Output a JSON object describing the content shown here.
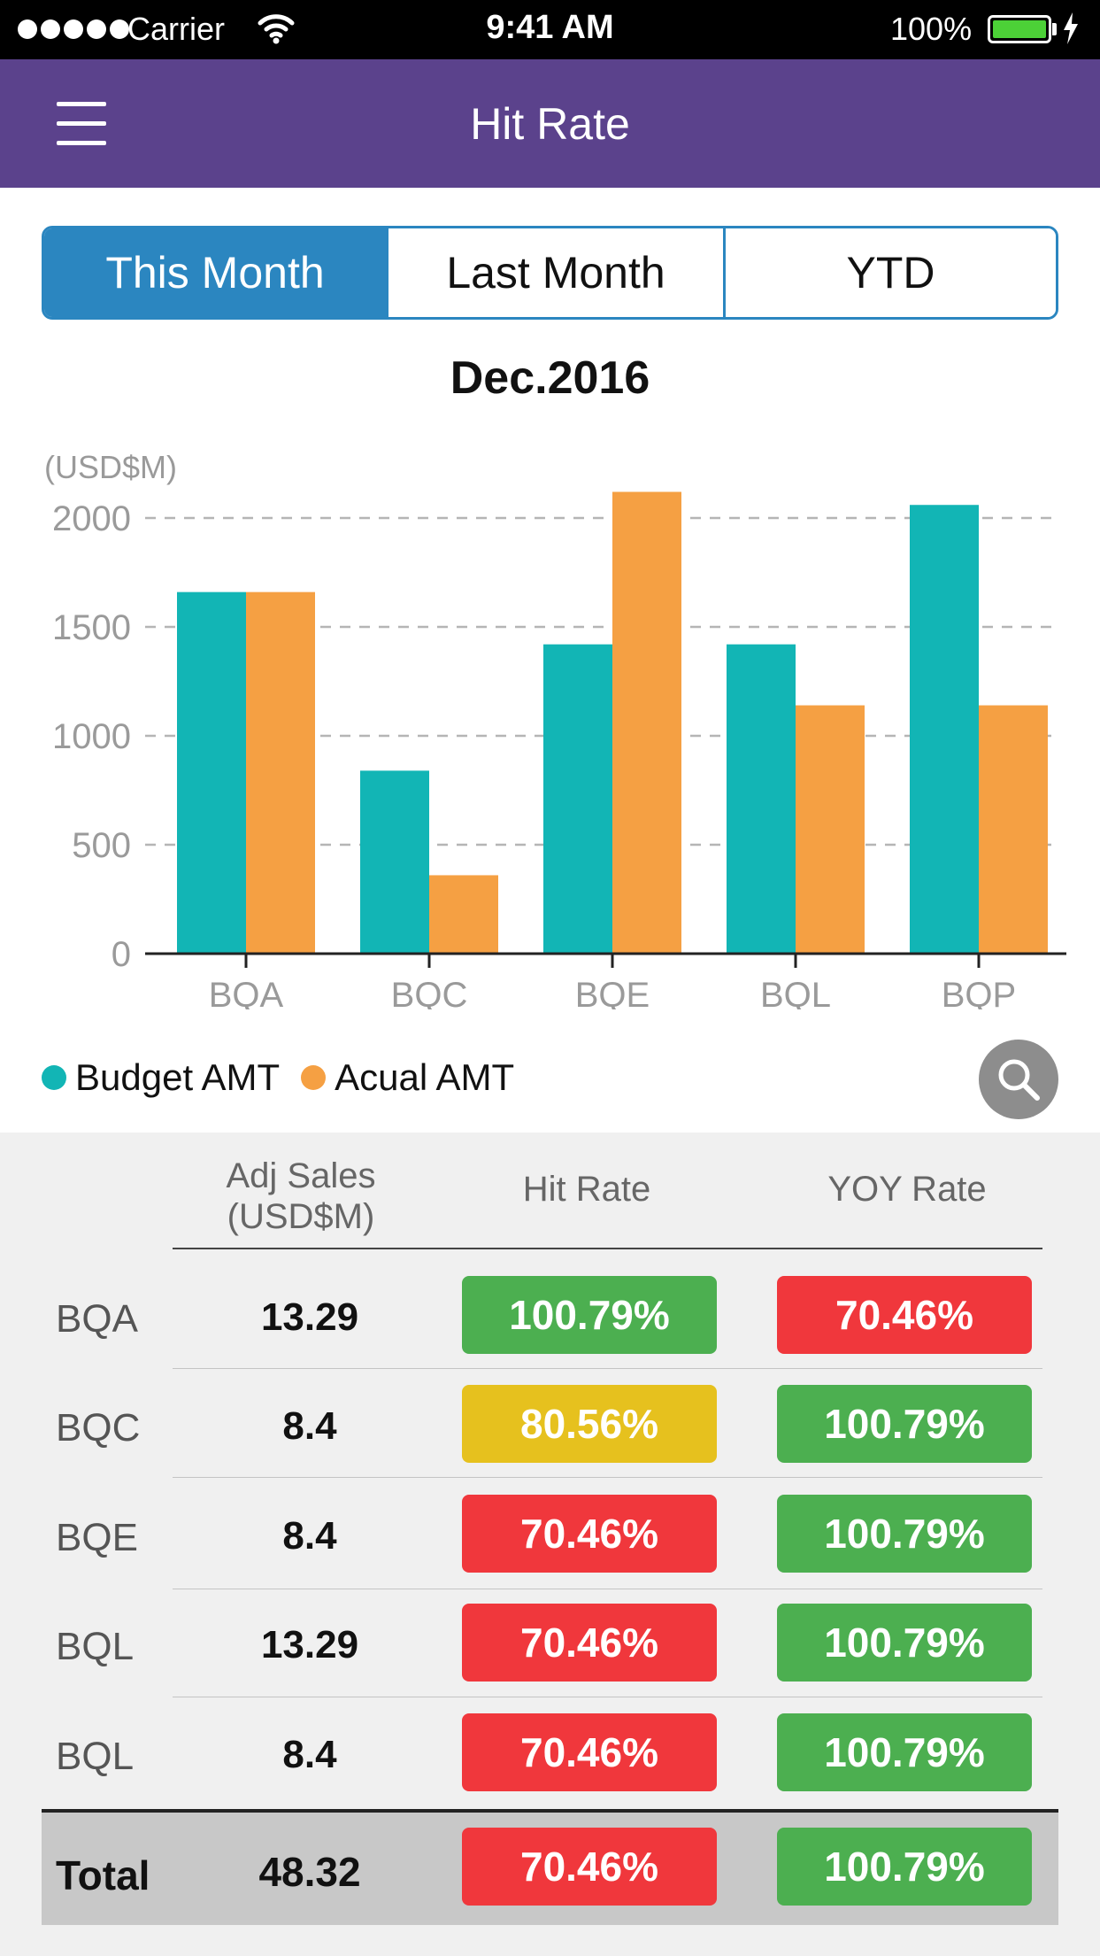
{
  "status_bar": {
    "carrier": "Carrier",
    "time": "9:41 AM",
    "battery": "100%"
  },
  "nav": {
    "title": "Hit Rate",
    "menu_icon": "hamburger-menu-icon"
  },
  "tabs": [
    {
      "label": "This Month",
      "active": true
    },
    {
      "label": "Last Month",
      "active": false
    },
    {
      "label": "YTD",
      "active": false
    }
  ],
  "period": "Dec.2016",
  "chart_data": {
    "type": "bar",
    "unit_label": "(USD$M)",
    "categories": [
      "BQA",
      "BQC",
      "BQE",
      "BQL",
      "BQP"
    ],
    "series": [
      {
        "name": "Budget AMT",
        "color": "#12b5b5",
        "values": [
          1660,
          840,
          1420,
          1420,
          2060
        ]
      },
      {
        "name": "Acual AMT",
        "color": "#f5a043",
        "values": [
          1660,
          360,
          2120,
          1140,
          1140
        ]
      }
    ],
    "yticks": [
      0,
      500,
      1000,
      1500,
      2000
    ],
    "ylim": [
      0,
      2200
    ],
    "grid": true,
    "legend": "bottom-left"
  },
  "search_icon": "search-icon",
  "table": {
    "headers": {
      "sales_line1": "Adj Sales",
      "sales_line2": "(USD$M)",
      "hit": "Hit Rate",
      "yoy": "YOY Rate"
    },
    "rows": [
      {
        "name": "BQA",
        "sales": "13.29",
        "hit": "100.79%",
        "hit_color": "#4caf50",
        "yoy": "70.46%",
        "yoy_color": "#f0373c"
      },
      {
        "name": "BQC",
        "sales": "8.4",
        "hit": "80.56%",
        "hit_color": "#e6c11e",
        "yoy": "100.79%",
        "yoy_color": "#4caf50"
      },
      {
        "name": "BQE",
        "sales": "8.4",
        "hit": "70.46%",
        "hit_color": "#f0373c",
        "yoy": "100.79%",
        "yoy_color": "#4caf50"
      },
      {
        "name": "BQL",
        "sales": "13.29",
        "hit": "70.46%",
        "hit_color": "#f0373c",
        "yoy": "100.79%",
        "yoy_color": "#4caf50"
      },
      {
        "name": "BQL",
        "sales": "8.4",
        "hit": "70.46%",
        "hit_color": "#f0373c",
        "yoy": "100.79%",
        "yoy_color": "#4caf50"
      }
    ],
    "total": {
      "name": "Total",
      "sales": "48.32",
      "hit": "70.46%",
      "hit_color": "#f0373c",
      "yoy": "100.79%",
      "yoy_color": "#4caf50"
    }
  }
}
